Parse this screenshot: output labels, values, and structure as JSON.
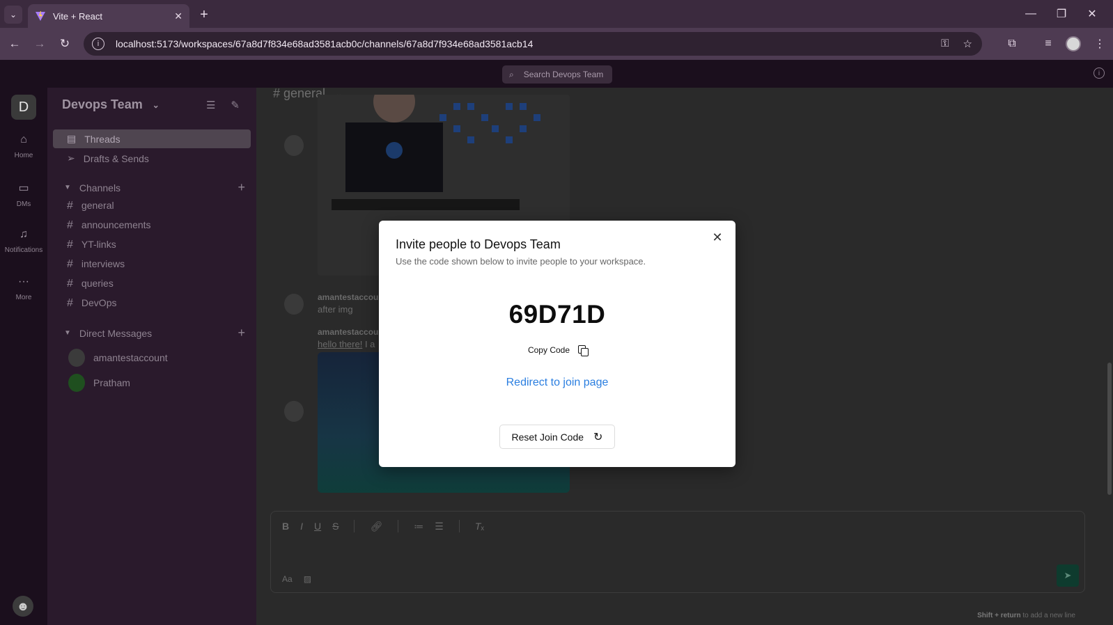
{
  "browser": {
    "tab_title": "Vite + React",
    "url": "localhost:5173/workspaces/67a8d7f834e68ad3581acb0c/channels/67a8d7f934e68ad3581acb14"
  },
  "topbar": {
    "search_placeholder": "Search Devops Team"
  },
  "rail": {
    "workspace_initial": "D",
    "items": [
      {
        "label": "Home",
        "icon": "home-icon"
      },
      {
        "label": "DMs",
        "icon": "message-icon"
      },
      {
        "label": "Notifications",
        "icon": "bell-icon"
      },
      {
        "label": "More",
        "icon": "more-icon"
      }
    ]
  },
  "sidebar": {
    "workspace_name": "Devops Team",
    "nav": [
      {
        "label": "Threads"
      },
      {
        "label": "Drafts & Sends"
      }
    ],
    "channels_label": "Channels",
    "channels": [
      "general",
      "announcements",
      "YT-links",
      "interviews",
      "queries",
      "DevOps"
    ],
    "dms_label": "Direct Messages",
    "dms": [
      "amantestaccount",
      "Pratham"
    ]
  },
  "channel": {
    "title": "# general",
    "messages": [
      {
        "author": "amantestaccou",
        "text": "after img"
      },
      {
        "author": "amantestaccou",
        "text_link": "hello there!",
        "text_rest": " I a"
      }
    ]
  },
  "editor": {
    "hint_bold": "Shift + return",
    "hint_rest": " to add a new line",
    "format_label": "Aa"
  },
  "modal": {
    "title": "Invite people to Devops Team",
    "subtitle": "Use the code shown below to invite people to your workspace.",
    "join_code": "69D71D",
    "copy_label": "Copy Code",
    "redirect_label": "Redirect to join page",
    "reset_label": "Reset Join Code"
  }
}
